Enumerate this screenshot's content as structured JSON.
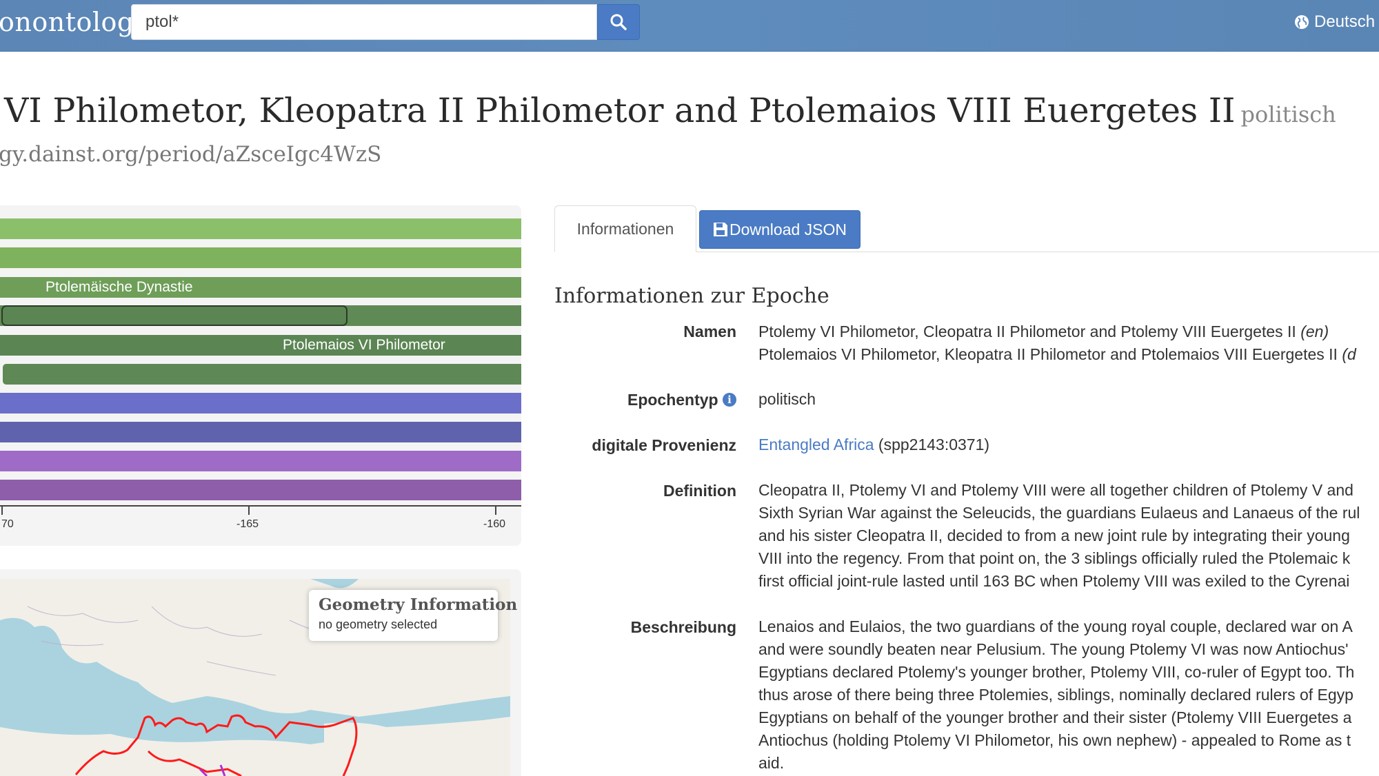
{
  "navbar": {
    "brand": "onontology",
    "search_value": "ptol*",
    "language": "Deutsch"
  },
  "header": {
    "title": "VI Philometor, Kleopatra II Philometor and Ptolemaios VIII Euergetes II",
    "type": "politisch",
    "uri": "gy.dainst.org/period/aZsceIgc4WzS"
  },
  "timeline": {
    "bars": [
      {
        "color": "#8cbf6a",
        "label": ""
      },
      {
        "color": "#7fb25d",
        "label": ""
      },
      {
        "color": "#6e9e58",
        "label": "Ptolemäische Dynastie"
      },
      {
        "color": "#5f8a55",
        "label": ""
      },
      {
        "color": "#5b8553",
        "label": "Ptolemaios VI Philometor"
      },
      {
        "color": "#5e8856",
        "label": ""
      },
      {
        "color": "#6b6fc9",
        "label": ""
      },
      {
        "color": "#5f63ad",
        "label": ""
      },
      {
        "color": "#9e6cc7",
        "label": ""
      },
      {
        "color": "#8f5eaa",
        "label": ""
      }
    ],
    "axis": {
      "ticks": [
        "70",
        "-165",
        "-160"
      ]
    }
  },
  "map": {
    "geometry_title": "Geometry Information",
    "geometry_status": "no geometry selected"
  },
  "tabs": {
    "info_label": "Informationen",
    "download_label": "Download JSON"
  },
  "info": {
    "heading": "Informationen zur Epoche",
    "names_label": "Namen",
    "names": [
      {
        "text": "Ptolemy VI Philometor, Cleopatra II Philometor and Ptolemy VIII Euergetes II",
        "lang": "(en)"
      },
      {
        "text": "Ptolemaios VI Philometor, Kleopatra II Philometor and Ptolemaios VIII Euergetes II",
        "lang": "(d"
      }
    ],
    "type_label": "Epochentyp",
    "type_value": "politisch",
    "provenance_label": "digitale Provenienz",
    "provenance_link": "Entangled Africa",
    "provenance_id": "(spp2143:0371)",
    "definition_label": "Definition",
    "definition_lines": [
      "Cleopatra II, Ptolemy VI and Ptolemy VIII were all together children of Ptolemy V and",
      "Sixth Syrian War against the Seleucids, the guardians Eulaeus and Lanaeus of the rul",
      "and his sister Cleopatra II, decided to from a new joint rule by integrating their young",
      "VIII into the regency. From that point on, the 3 siblings officially ruled the Ptolemaic k",
      "first official joint-rule lasted until 163 BC when Ptolemy VIII was exiled to the Cyrenai"
    ],
    "description_label": "Beschreibung",
    "description_lines": [
      "Lenaios and Eulaios, the two guardians of the young royal couple, declared war on A",
      "and were soundly beaten near Pelusium. The young Ptolemy VI was now Antiochus'",
      "Egyptians declared Ptolemy's younger brother, Ptolemy VIII, co-ruler of Egypt too. Th",
      "thus arose of there being three Ptolemies, siblings, nominally declared rulers of Egyp",
      "Egyptians on behalf of the younger brother and their sister (Ptolemy VIII Euergetes a",
      "Antiochus (holding Ptolemy VI Philometor, his own nephew) - appealed to Rome as t",
      "aid."
    ]
  }
}
